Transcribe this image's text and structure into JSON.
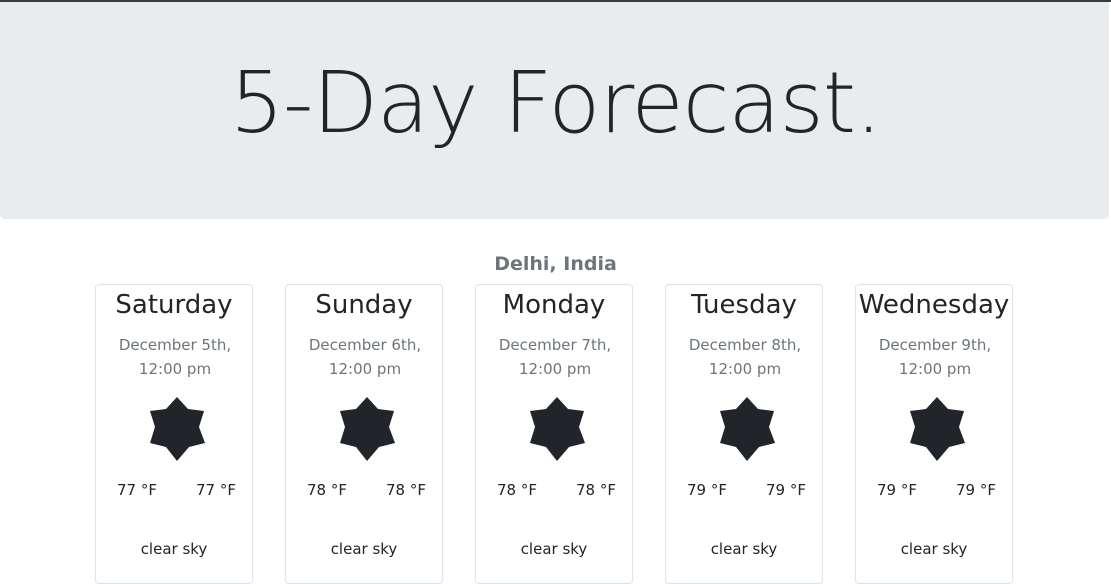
{
  "header": {
    "title": "5-Day Forecast."
  },
  "location": "Delhi, India",
  "forecast": [
    {
      "day": "Saturday",
      "date": "December 5th, 12:00 pm",
      "icon": "sun-icon",
      "temp_low": "77 °F",
      "temp_high": "77 °F",
      "description": "clear sky"
    },
    {
      "day": "Sunday",
      "date": "December 6th, 12:00 pm",
      "icon": "sun-icon",
      "temp_low": "78 °F",
      "temp_high": "78 °F",
      "description": "clear sky"
    },
    {
      "day": "Monday",
      "date": "December 7th, 12:00 pm",
      "icon": "sun-icon",
      "temp_low": "78 °F",
      "temp_high": "78 °F",
      "description": "clear sky"
    },
    {
      "day": "Tuesday",
      "date": "December 8th, 12:00 pm",
      "icon": "sun-icon",
      "temp_low": "79 °F",
      "temp_high": "79 °F",
      "description": "clear sky"
    },
    {
      "day": "Wednesday",
      "date": "December 9th, 12:00 pm",
      "icon": "sun-icon",
      "temp_low": "79 °F",
      "temp_high": "79 °F",
      "description": "clear sky"
    }
  ],
  "colors": {
    "jumbotron_bg": "#e9ecef",
    "text": "#212529",
    "muted": "#6c757d",
    "card_border": "#dee2e6"
  }
}
